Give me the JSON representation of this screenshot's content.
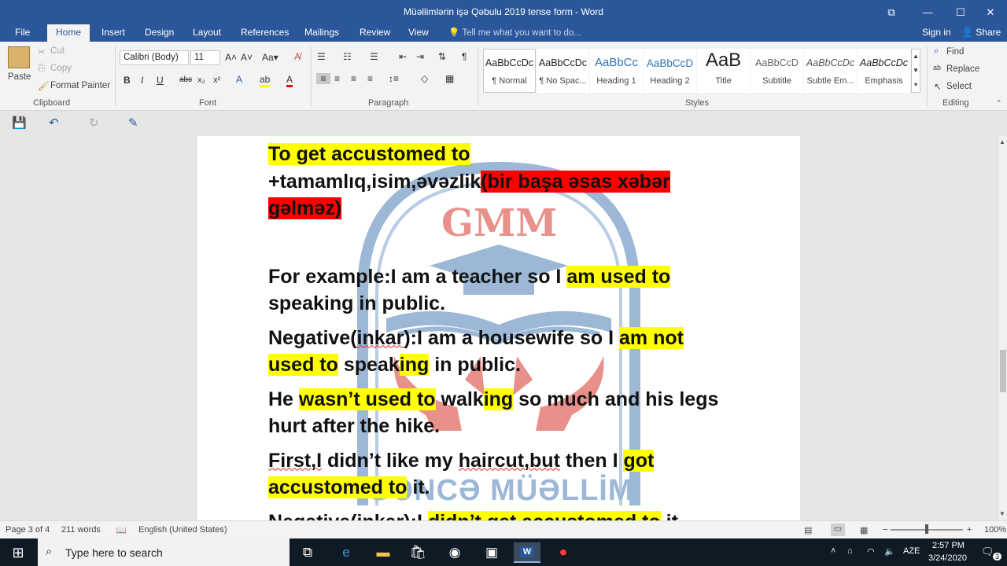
{
  "window": {
    "title": "Müəllimlərin işə Qəbulu 2019 tense form - Word",
    "restore_icon": "⧉",
    "minimize": "—",
    "maximize": "☐",
    "close": "✕"
  },
  "tabs": [
    "File",
    "Home",
    "Insert",
    "Design",
    "Layout",
    "References",
    "Mailings",
    "Review",
    "View"
  ],
  "tell_me": "Tell me what you want to do...",
  "sign_in": "Sign in",
  "share": "Share",
  "clipboard": {
    "paste": "Paste",
    "cut": "Cut",
    "copy": "Copy",
    "format_painter": "Format Painter",
    "label": "Clipboard"
  },
  "font": {
    "family": "Calibri (Body)",
    "size": "11",
    "label": "Font"
  },
  "paragraph": {
    "label": "Paragraph"
  },
  "styles": {
    "label": "Styles",
    "items": [
      {
        "preview": "AaBbCcDc",
        "name": "¶ Normal"
      },
      {
        "preview": "AaBbCcDc",
        "name": "¶ No Spac..."
      },
      {
        "preview": "AaBbCc",
        "name": "Heading 1"
      },
      {
        "preview": "AaBbCcD",
        "name": "Heading 2"
      },
      {
        "preview": "AaB",
        "name": "Title"
      },
      {
        "preview": "AaBbCcD",
        "name": "Subtitle"
      },
      {
        "preview": "AaBbCcDc",
        "name": "Subtle Em..."
      },
      {
        "preview": "AaBbCcDc",
        "name": "Emphasis"
      }
    ]
  },
  "editing": {
    "find": "Find",
    "replace": "Replace",
    "select": "Select",
    "label": "Editing"
  },
  "document": {
    "heading": "To get accustomed to",
    "line2a": "+tamamlıq,isim,əvəzlik",
    "line2b": "(bir başa əsas xəbər gəlməz)",
    "ex1a": "For example:I am a teacher so I ",
    "ex1b": "am used to",
    "ex1c": " speaking in public.",
    "neg1a": "Negative(",
    "neg1b": "inkar",
    "neg1c": "):I am a housewife so I ",
    "neg1d": "am not used to",
    "neg1e": " speak",
    "neg1f": "ing",
    "neg1g": " in public.",
    "he_a": " He ",
    "he_b": "wasn’t used to",
    "he_c": " walk",
    "he_d": "ing",
    "he_e": " so much and his legs hurt after the hike.",
    "first_a": "First,I",
    "first_b": " didn’t like my ",
    "first_c": "haircut,but",
    "first_d": " then I ",
    "first_e": "got accustomed to",
    "first_f": " it.",
    "neg2a": "Negative(inkar):I ",
    "neg2b": "didn’t get accustomed to",
    "neg2c": " it"
  },
  "watermark": {
    "top": "GMM",
    "bottom": "GƏNCƏ MÜƏLLİM"
  },
  "status": {
    "page": "Page 3 of 4",
    "words": "211 words",
    "language": "English (United States)",
    "zoom": "100%"
  },
  "taskbar": {
    "search_placeholder": "Type here to search",
    "lang": "AZE",
    "time": "2:57 PM",
    "date": "3/24/2020",
    "notifications": "3"
  }
}
